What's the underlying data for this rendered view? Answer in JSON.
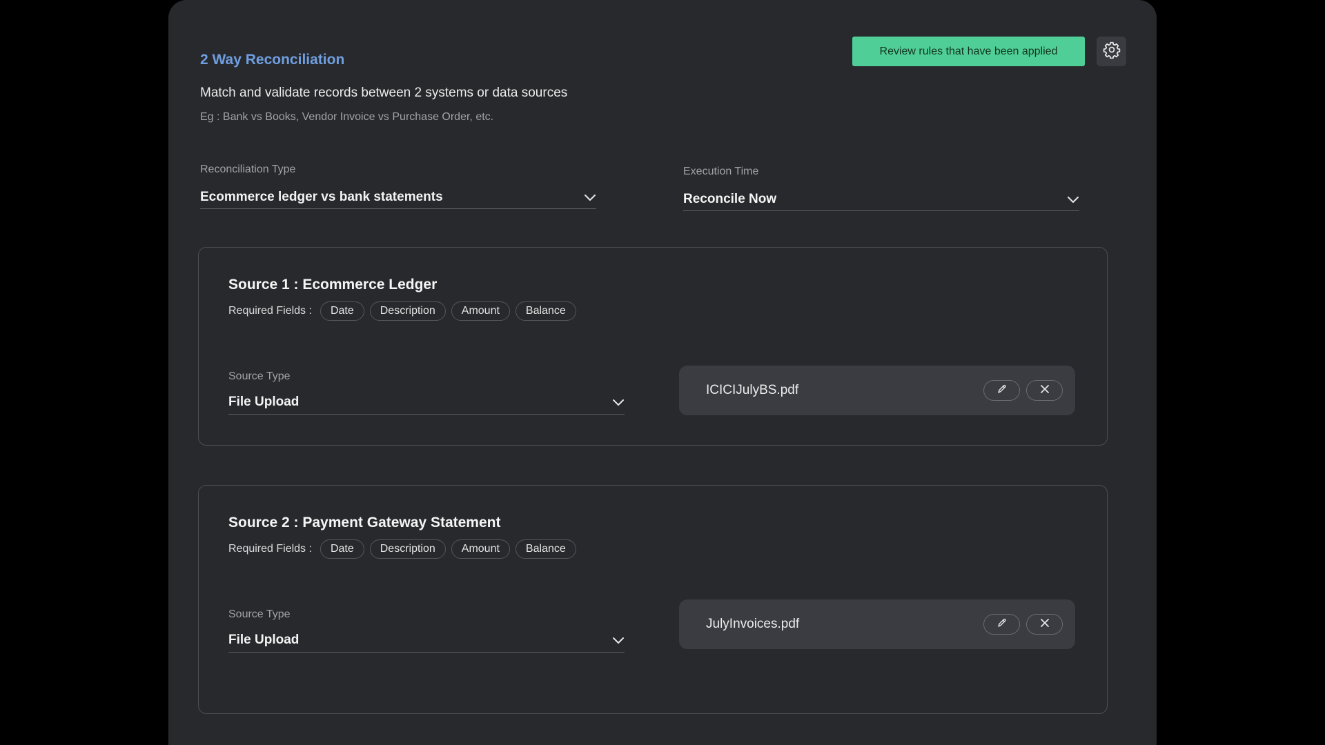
{
  "header": {
    "title": "2 Way Reconciliation",
    "subtitle": "Match and validate records between 2 systems or data sources",
    "example": "Eg : Bank vs Books, Vendor Invoice vs Purchase Order, etc.",
    "review_button": "Review rules that have been applied",
    "settings_icon": "gear-icon"
  },
  "reconciliation_type": {
    "label": "Reconciliation Type",
    "value": "Ecommerce ledger vs bank statements"
  },
  "execution_time": {
    "label": "Execution Time",
    "value": "Reconcile Now"
  },
  "sources": [
    {
      "title": "Source 1 : Ecommerce Ledger",
      "required_label": "Required Fields :",
      "fields": [
        "Date",
        "Description",
        "Amount",
        "Balance"
      ],
      "source_type_label": "Source Type",
      "source_type_value": "File Upload",
      "file_name": "ICICIJulyBS.pdf"
    },
    {
      "title": "Source 2 : Payment Gateway Statement",
      "required_label": "Required Fields :",
      "fields": [
        "Date",
        "Description",
        "Amount",
        "Balance"
      ],
      "source_type_label": "Source Type",
      "source_type_value": "File Upload",
      "file_name": "JulyInvoices.pdf"
    }
  ],
  "colors": {
    "accent_title": "#6f9fe0",
    "review_button_bg": "#4fcf97",
    "panel_bg": "#28292d"
  }
}
